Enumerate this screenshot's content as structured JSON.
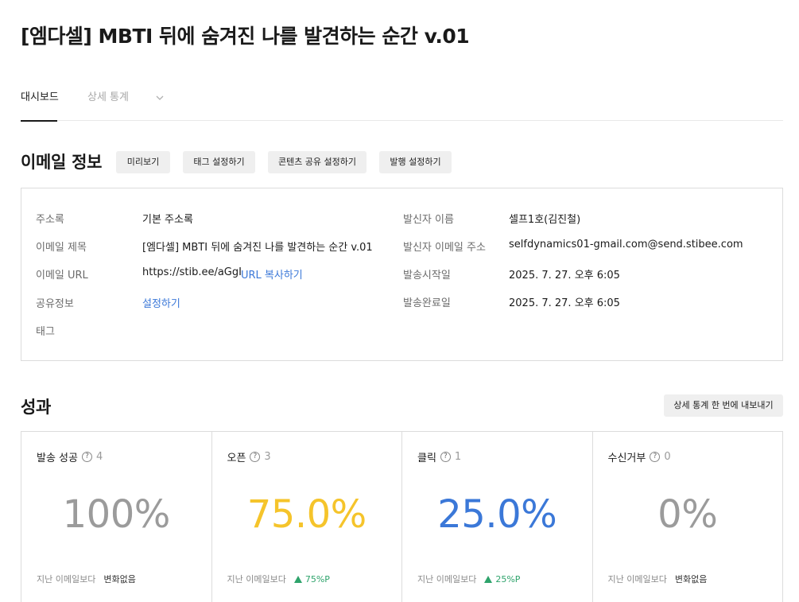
{
  "page": {
    "title": "[엠다셀] MBTI 뒤에 숨겨진 나를 발견하는 순간 v.01"
  },
  "tabs": [
    {
      "label": "대시보드",
      "active": true
    },
    {
      "label": "상세 통계",
      "active": false
    }
  ],
  "email_info": {
    "title": "이메일 정보",
    "buttons": {
      "preview": "미리보기",
      "tag_settings": "태그 설정하기",
      "content_share": "콘텐츠 공유 설정하기",
      "publish_settings": "발행 설정하기"
    },
    "left": {
      "address_book_label": "주소록",
      "address_book_value": "기본 주소록",
      "subject_label": "이메일 제목",
      "subject_value": "[엠다셀] MBTI 뒤에 숨겨진 나를 발견하는 순간 v.01",
      "url_label": "이메일 URL",
      "url_value": "https://stib.ee/aGgI",
      "url_copy": "URL 복사하기",
      "share_label": "공유정보",
      "share_value": "설정하기",
      "tag_label": "태그"
    },
    "right": {
      "sender_name_label": "발신자 이름",
      "sender_name_value": "셀프1호(김진철)",
      "sender_email_label": "발신자 이메일 주소",
      "sender_email_value": "selfdynamics01-gmail.com@send.stibee.com",
      "send_start_label": "발송시작일",
      "send_start_value": "2025. 7. 27. 오후 6:05",
      "send_end_label": "발송완료일",
      "send_end_value": "2025. 7. 27. 오후 6:05"
    }
  },
  "performance": {
    "title": "성과",
    "export_button": "상세 통계 한 번에 내보내기",
    "compare_label": "지난 이메일보다",
    "metrics": [
      {
        "label": "발송 성공",
        "count": "4",
        "value": "100%",
        "color": "#9b9b9b",
        "delta": "변화없음",
        "trend": "none"
      },
      {
        "label": "오픈",
        "count": "3",
        "value": "75.0%",
        "color": "#f5c42b",
        "delta": "75%P",
        "trend": "up"
      },
      {
        "label": "클릭",
        "count": "1",
        "value": "25.0%",
        "color": "#3b78d8",
        "delta": "25%P",
        "trend": "up"
      },
      {
        "label": "수신거부",
        "count": "0",
        "value": "0%",
        "color": "#9b9b9b",
        "delta": "변화없음",
        "trend": "none"
      }
    ]
  },
  "colors": {
    "accent_link": "#3b78d8",
    "positive": "#2ea36b"
  }
}
